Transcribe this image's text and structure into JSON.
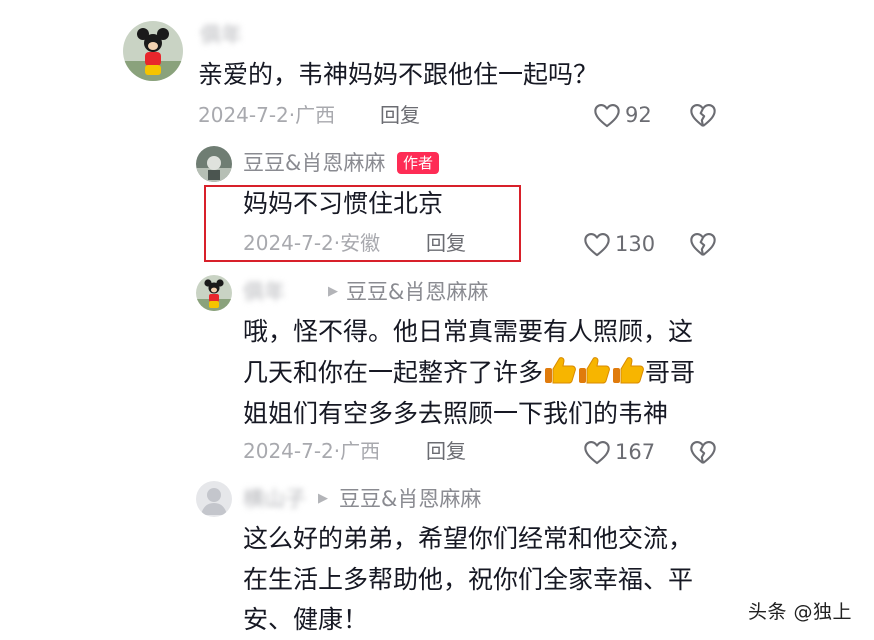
{
  "comments": [
    {
      "username": "俱年",
      "text": "亲爱的，韦神妈妈不跟他住一起吗？",
      "meta": "2024-7-2·广西",
      "reply_label": "回复",
      "likes": "92"
    },
    {
      "username": "豆豆&肖恩麻麻",
      "badge": "作者",
      "text": "妈妈不习惯住北京",
      "meta": "2024-7-2·安徽",
      "reply_label": "回复",
      "likes": "130"
    },
    {
      "username": "俱年",
      "reply_to": "豆豆&肖恩麻麻",
      "text_line1": "哦，怪不得。他日常真需要有人照顾，这",
      "text_line2": "几天和你在一起整齐了许多",
      "text_line2_end": "哥哥",
      "text_line3": "姐姐们有空多多去照顾一下我们的韦神",
      "meta": "2024-7-2·广西",
      "reply_label": "回复",
      "likes": "167"
    },
    {
      "username": "横山子",
      "reply_to": "豆豆&肖恩麻麻",
      "text_line1": "这么好的弟弟，希望你们经常和他交流，",
      "text_line2": "在生活上多帮助他，祝你们全家幸福、平",
      "text_line3": "安、健康！"
    }
  ],
  "icons": {
    "like": "heart-outline-icon",
    "dislike": "broken-heart-icon",
    "reply_arrow": "triangle-right-icon",
    "emoji": "thumbs-up-icon"
  },
  "watermark": "头条 @独上",
  "colors": {
    "author_badge": "#fe2c55",
    "highlight_box": "#d8202a",
    "muted_text": "#a8a9ae"
  }
}
